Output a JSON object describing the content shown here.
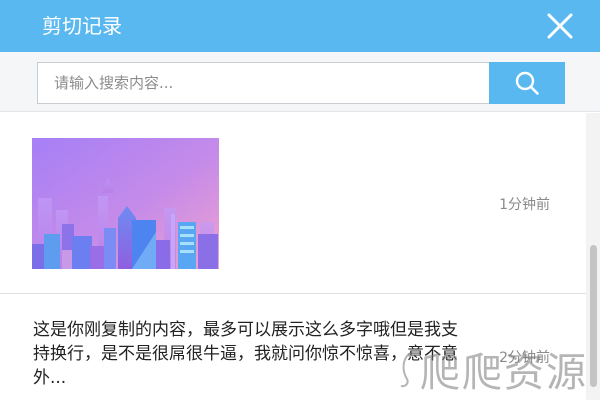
{
  "window": {
    "title": "剪切记录"
  },
  "icons": {
    "close": "close-icon",
    "search": "search-icon"
  },
  "search": {
    "placeholder": "请输入搜索内容...",
    "value": ""
  },
  "records": [
    {
      "type": "image",
      "image": "city-skyline-illustration",
      "time": "1分钟前"
    },
    {
      "type": "text",
      "text": "这是你刚复制的内容，最多可以展示这么多字哦但是我支持换行，是不是很屌很牛逼，我就问你惊不惊喜，意不意外...",
      "time": "2分钟前"
    }
  ],
  "watermark": {
    "text": "爬爬资源"
  },
  "colors": {
    "accent": "#5ab8f1",
    "muted_text": "#8a8a8a"
  }
}
